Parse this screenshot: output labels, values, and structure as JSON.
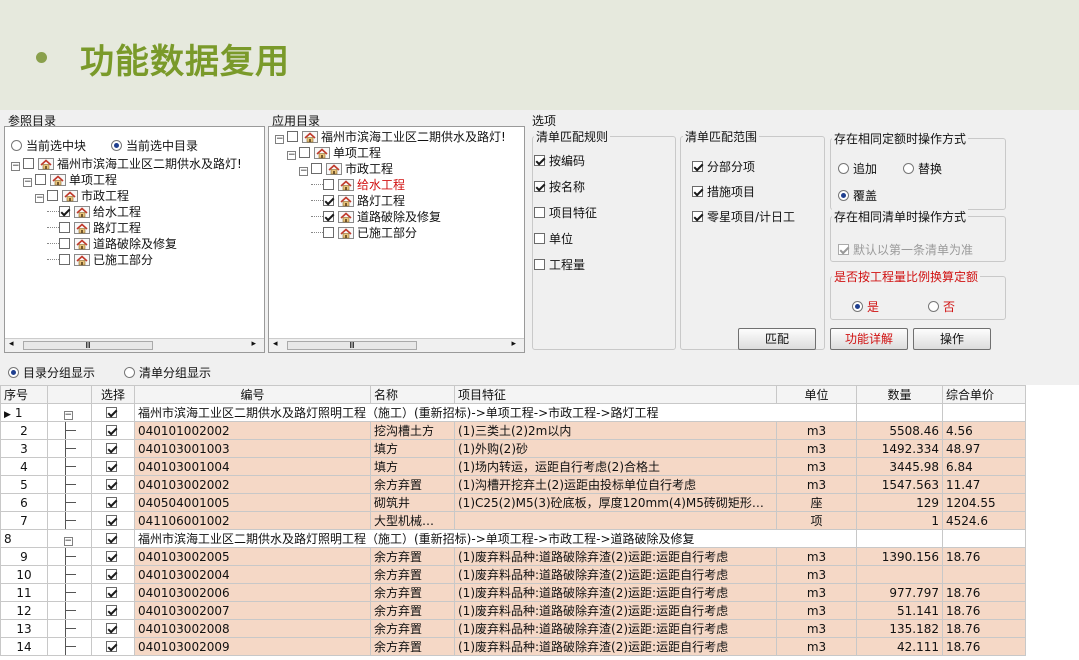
{
  "slide": {
    "title": "功能数据复用"
  },
  "ref_dir": {
    "label": "参照目录",
    "radio_block": "当前选中块",
    "radio_dir": "当前选中目录",
    "tree": [
      {
        "label": "福州市滨海工业区二期供水及路灯!",
        "checked": false,
        "level": 0
      },
      {
        "label": "单项工程",
        "checked": false,
        "level": 1
      },
      {
        "label": "市政工程",
        "checked": false,
        "level": 2
      },
      {
        "label": "给水工程",
        "checked": true,
        "level": 3
      },
      {
        "label": "路灯工程",
        "checked": false,
        "level": 3
      },
      {
        "label": "道路破除及修复",
        "checked": false,
        "level": 3
      },
      {
        "label": "已施工部分",
        "checked": false,
        "level": 3
      }
    ],
    "scroll_glyph": "Ⅲ"
  },
  "app_dir": {
    "label": "应用目录",
    "tree": [
      {
        "label": "福州市滨海工业区二期供水及路灯!",
        "checked": false,
        "level": 0
      },
      {
        "label": "单项工程",
        "checked": false,
        "level": 1
      },
      {
        "label": "市政工程",
        "checked": false,
        "level": 2
      },
      {
        "label": "给水工程",
        "checked": false,
        "level": 3,
        "red": true
      },
      {
        "label": "路灯工程",
        "checked": true,
        "level": 3
      },
      {
        "label": "道路破除及修复",
        "checked": true,
        "level": 3
      },
      {
        "label": "已施工部分",
        "checked": false,
        "level": 3
      }
    ],
    "scroll_glyph": "Ⅲ"
  },
  "options": {
    "label": "选项",
    "match_rule": {
      "title": "清单匹配规则",
      "items": [
        "按编码",
        "按名称",
        "项目特征",
        "单位",
        "工程量"
      ]
    },
    "match_scope": {
      "title": "清单匹配范围",
      "items": [
        "分部分项",
        "措施项目",
        "零星项目/计日工"
      ]
    },
    "same_quota": {
      "title": "存在相同定额时操作方式",
      "append": "追加",
      "replace": "替换",
      "cover": "覆盖"
    },
    "same_list": {
      "title": "存在相同清单时操作方式",
      "default_first": "默认以第一条清单为准"
    },
    "ratio": {
      "title": "是否按工程量比例换算定额",
      "yes": "是",
      "no": "否"
    },
    "buttons": {
      "match": "匹配",
      "detail": "功能详解",
      "operate": "操作"
    }
  },
  "display_mode": {
    "dir_group": "目录分组显示",
    "list_group": "清单分组显示"
  },
  "table": {
    "headers": [
      "序号",
      "",
      "选择",
      "编号",
      "名称",
      "项目特征",
      "单位",
      "数量",
      "综合单价"
    ],
    "rows": [
      {
        "no": "1",
        "group": true,
        "code": "福州市滨海工业区二期供水及路灯照明工程（施工）(重新招标)->单项工程->市政工程->路灯工程"
      },
      {
        "no": "2",
        "code": "040101002002",
        "name": "挖沟槽土方",
        "feature": "(1)三类土(2)2m以内",
        "unit": "m3",
        "qty": "5508.46",
        "price": "4.56"
      },
      {
        "no": "3",
        "code": "040103001003",
        "name": "填方",
        "feature": "(1)外购(2)砂",
        "unit": "m3",
        "qty": "1492.334",
        "price": "48.97"
      },
      {
        "no": "4",
        "code": "040103001004",
        "name": "填方",
        "feature": "(1)场内转运，运距自行考虑(2)合格土",
        "unit": "m3",
        "qty": "3445.98",
        "price": "6.84"
      },
      {
        "no": "5",
        "code": "040103002002",
        "name": "余方弃置",
        "feature": "(1)沟槽开挖弃土(2)运距由投标单位自行考虑",
        "unit": "m3",
        "qty": "1547.563",
        "price": "11.47"
      },
      {
        "no": "6",
        "code": "040504001005",
        "name": "砌筑井",
        "feature": "(1)C25(2)M5(3)砼底板，厚度120mm(4)M5砖砌矩形…",
        "unit": "座",
        "qty": "129",
        "price": "1204.55"
      },
      {
        "no": "7",
        "code": "041106001002",
        "name": "大型机械…",
        "feature": "",
        "unit": "项",
        "qty": "1",
        "price": "4524.6",
        "last": true
      },
      {
        "no": "8",
        "group": true,
        "code": "福州市滨海工业区二期供水及路灯照明工程（施工）(重新招标)->单项工程->市政工程->道路破除及修复"
      },
      {
        "no": "9",
        "code": "040103002005",
        "name": "余方弃置",
        "feature": "(1)废弃料品种:道路破除弃渣(2)运距:运距自行考虑",
        "unit": "m3",
        "qty": "1390.156",
        "price": "18.76"
      },
      {
        "no": "10",
        "code": "040103002004",
        "name": "余方弃置",
        "feature": "(1)废弃料品种:道路破除弃渣(2)运距:运距自行考虑",
        "unit": "m3",
        "qty": "",
        "price": ""
      },
      {
        "no": "11",
        "code": "040103002006",
        "name": "余方弃置",
        "feature": "(1)废弃料品种:道路破除弃渣(2)运距:运距自行考虑",
        "unit": "m3",
        "qty": "977.797",
        "price": "18.76"
      },
      {
        "no": "12",
        "code": "040103002007",
        "name": "余方弃置",
        "feature": "(1)废弃料品种:道路破除弃渣(2)运距:运距自行考虑",
        "unit": "m3",
        "qty": "51.141",
        "price": "18.76"
      },
      {
        "no": "13",
        "code": "040103002008",
        "name": "余方弃置",
        "feature": "(1)废弃料品种:道路破除弃渣(2)运距:运距自行考虑",
        "unit": "m3",
        "qty": "135.182",
        "price": "18.76"
      },
      {
        "no": "14",
        "code": "040103002009",
        "name": "余方弃置",
        "feature": "(1)废弃料品种:道路破除弃渣(2)运距:运距自行考虑",
        "unit": "m3",
        "qty": "42.111",
        "price": "18.76"
      }
    ]
  },
  "colors": {
    "title": "#7a9a2a",
    "highlight": "#f5d8c6",
    "red_text": "#d01010"
  }
}
